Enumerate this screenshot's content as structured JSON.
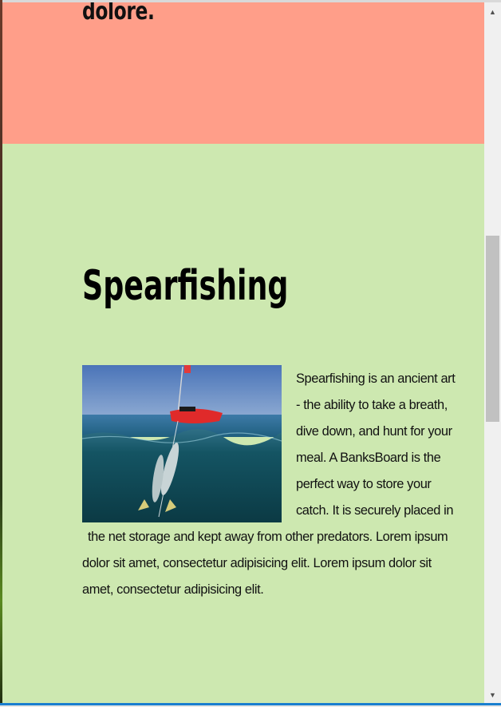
{
  "previous_section": {
    "trailing_text": "dolore."
  },
  "spearfishing": {
    "heading": "Spearfishing",
    "image_alt": "Spearfishing catch below a red kayak",
    "body_first": "Spearfishing is an ancient art - the ability to take a breath, dive down, and hunt for your meal. A BanksBoard is the perfect way to store your catch. It is securely placed in",
    "body_rest": "the net storage and kept away from other predators. Lorem ipsum dolor sit amet, consectetur adipisicing elit. Lorem ipsum dolor sit amet, consectetur adipisicing elit."
  },
  "colors": {
    "salmon_section": "#ff9e89",
    "green_section": "#cde8b0",
    "accent_bar": "#1a7fcf"
  },
  "scrollbar": {
    "up_icon": "scroll-up-arrow",
    "down_icon": "scroll-down-arrow"
  }
}
